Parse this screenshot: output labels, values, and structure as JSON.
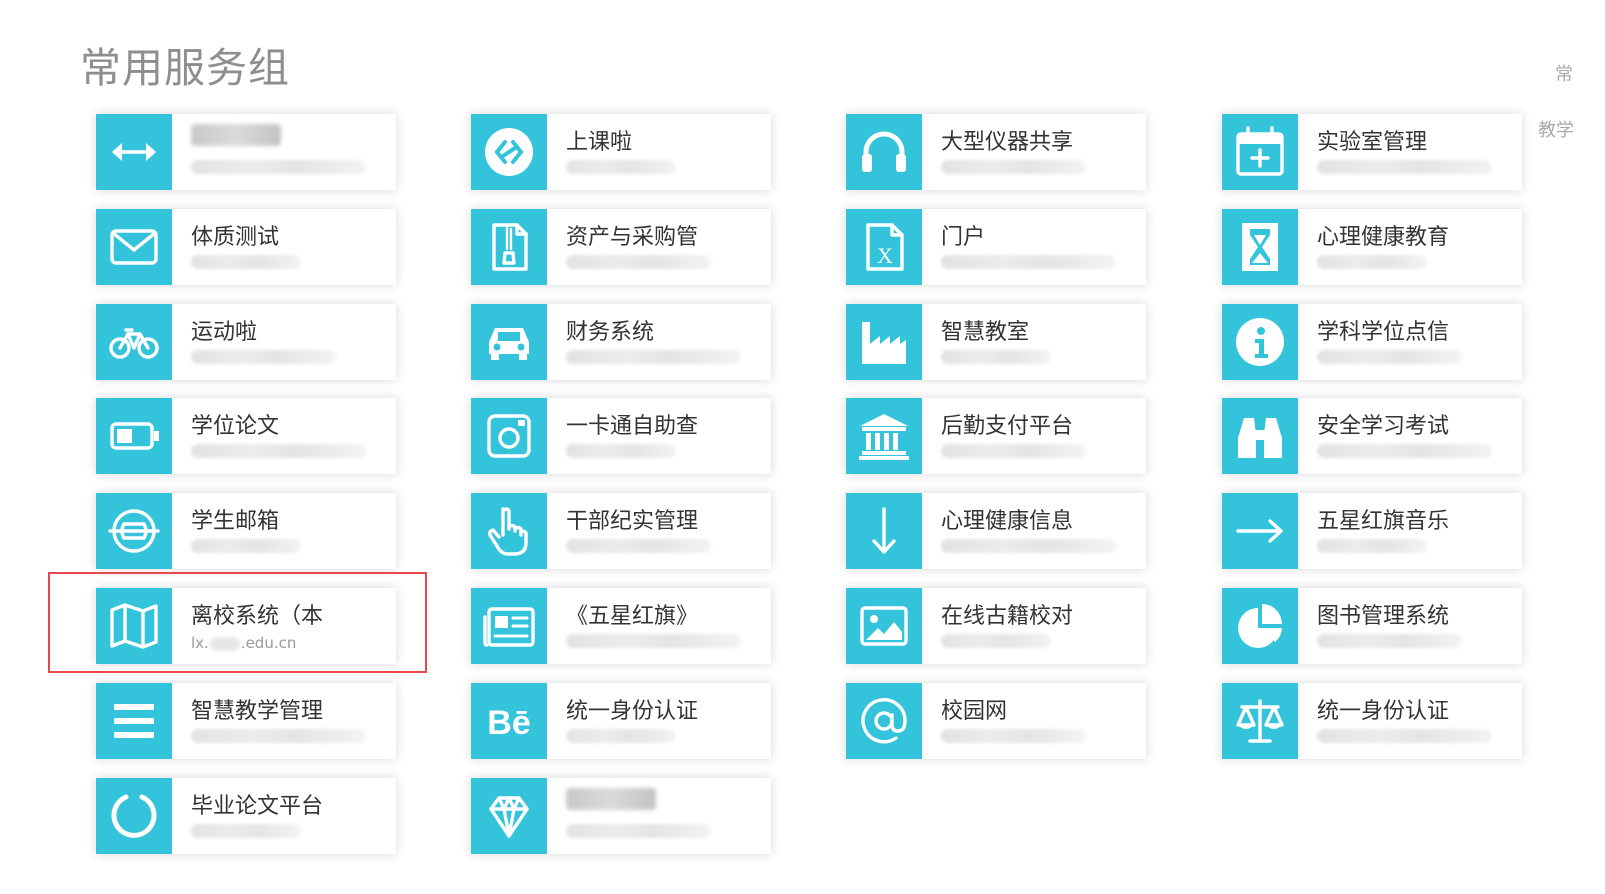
{
  "title": "常用服务组",
  "edge_texts": [
    "常",
    "教学"
  ],
  "accent_color": "#33c3da",
  "highlight_color": "#e8484c",
  "columns": [
    [
      {
        "name": "",
        "icon": "arrows-horizontal-icon"
      },
      {
        "name": "体质测试",
        "icon": "envelope-icon"
      },
      {
        "name": "运动啦",
        "icon": "bicycle-icon"
      },
      {
        "name": "学位论文",
        "icon": "battery-icon"
      },
      {
        "name": "学生邮箱",
        "icon": "circle-emblem-icon"
      },
      {
        "name": "离校系统（本",
        "icon": "map-icon",
        "url_prefix": "lx.",
        "url_suffix": ".edu.cn"
      },
      {
        "name": "智慧教学管理",
        "icon": "menu-lines-icon"
      },
      {
        "name": "毕业论文平台",
        "icon": "circle-ring-icon"
      }
    ],
    [
      {
        "name": "上课啦",
        "icon": "link-diamond-icon"
      },
      {
        "name": "资产与采购管",
        "icon": "zip-file-icon"
      },
      {
        "name": "财务系统",
        "icon": "car-icon"
      },
      {
        "name": "一卡通自助查",
        "icon": "instagram-icon"
      },
      {
        "name": "干部纪实管理",
        "icon": "hand-pointer-icon"
      },
      {
        "name": "《五星红旗》",
        "icon": "newspaper-icon"
      },
      {
        "name": "统一身份认证",
        "icon": "behance-icon"
      },
      {
        "name": "",
        "icon": "diamond-icon"
      }
    ],
    [
      {
        "name": "大型仪器共享",
        "icon": "headphones-icon"
      },
      {
        "name": "门户",
        "icon": "excel-file-icon"
      },
      {
        "name": "智慧教室",
        "icon": "factory-icon"
      },
      {
        "name": "后勤支付平台",
        "icon": "bank-icon"
      },
      {
        "name": "心理健康信息",
        "icon": "arrow-down-icon"
      },
      {
        "name": "在线古籍校对",
        "icon": "image-icon"
      },
      {
        "name": "校园网",
        "icon": "at-sign-icon"
      }
    ],
    [
      {
        "name": "实验室管理",
        "icon": "calendar-plus-icon"
      },
      {
        "name": "心理健康教育",
        "icon": "hourglass-icon"
      },
      {
        "name": "学科学位点信",
        "icon": "info-icon"
      },
      {
        "name": "安全学习考试",
        "icon": "binoculars-icon"
      },
      {
        "name": "五星红旗音乐",
        "icon": "arrow-right-icon"
      },
      {
        "name": "图书管理系统",
        "icon": "pie-chart-icon"
      },
      {
        "name": "统一身份认证",
        "icon": "scale-icon"
      }
    ]
  ]
}
